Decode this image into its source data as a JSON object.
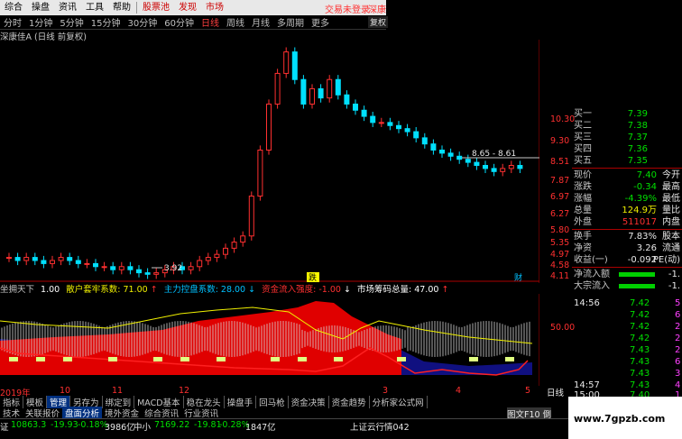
{
  "menu": {
    "items": [
      "综合",
      "操盘",
      "资讯",
      "工具",
      "帮助"
    ],
    "red_items": [
      "股票池",
      "发现",
      "市场"
    ],
    "login_text": "交易未登录",
    "account_text": "深康"
  },
  "periods": {
    "items": [
      "分时",
      "1分钟",
      "5分钟",
      "15分钟",
      "30分钟",
      "60分钟",
      "日线",
      "周线",
      "月线",
      "多周期",
      "更多"
    ],
    "active": "日线",
    "fq_button": "复权"
  },
  "stock_title": "深康佳A (日线 前复权)",
  "price_axis": [
    "10.30",
    "9.30",
    "8.51",
    "7.87",
    "6.97",
    "6.27",
    "5.80",
    "5.35",
    "4.97",
    "4.58",
    "4.11"
  ],
  "chart_annotations": {
    "range_label": "8.65 - 8.61",
    "low_label": "3.92",
    "fall_label": "跌",
    "finance_label": "财"
  },
  "chart_data": {
    "type": "candlestick",
    "ohlc_close_approx": [
      4.5,
      4.4,
      4.5,
      4.4,
      4.3,
      4.4,
      4.5,
      4.4,
      4.3,
      4.3,
      4.2,
      4.2,
      4.1,
      4.2,
      4.1,
      4.0,
      3.95,
      4.0,
      4.1,
      4.2,
      4.1,
      4.2,
      4.4,
      4.5,
      4.6,
      4.8,
      5.0,
      5.2,
      6.5,
      8.0,
      9.5,
      10.5,
      11.2,
      10.3,
      9.5,
      10.0,
      9.7,
      10.3,
      9.8,
      9.5,
      9.3,
      9.1,
      8.9,
      8.9,
      8.8,
      8.7,
      8.6,
      8.4,
      8.2,
      8.0,
      7.9,
      7.8,
      7.7,
      7.6,
      7.5,
      7.4,
      7.3,
      7.4,
      7.5,
      7.4
    ],
    "ylim": [
      3.9,
      11.6
    ]
  },
  "indicator": {
    "name": "坐拥天下",
    "items": [
      {
        "label": "1.00",
        "color": "#ffffff"
      },
      {
        "label": "散户套牢系数: 71.00",
        "color": "#f0f000"
      },
      {
        "label": "↑",
        "color": "#ff3030"
      },
      {
        "label": "主力控盘系数: 28.00",
        "color": "#00c0ff"
      },
      {
        "label": "↓",
        "color": "#00c0ff"
      },
      {
        "label": "资金流入强度: -1.00",
        "color": "#ff3030"
      },
      {
        "label": "↓",
        "color": "#ffffff"
      },
      {
        "label": "市场筹码总量: 47.00",
        "color": "#ffffff"
      },
      {
        "label": "↑",
        "color": "#ff3030"
      }
    ],
    "axis_label": "50.00"
  },
  "quote": {
    "rows": [
      {
        "label": "买一",
        "value": "7.39",
        "vcls": "green"
      },
      {
        "label": "买二",
        "value": "7.38",
        "vcls": "green"
      },
      {
        "label": "买三",
        "value": "7.37",
        "vcls": "green"
      },
      {
        "label": "买四",
        "value": "7.36",
        "vcls": "green"
      },
      {
        "label": "买五",
        "value": "7.35",
        "vcls": "green"
      }
    ],
    "stats": [
      {
        "label": "现价",
        "value": "7.40",
        "vcls": "green",
        "tail": "今开"
      },
      {
        "label": "涨跌",
        "value": "-0.34",
        "vcls": "green",
        "tail": "最高"
      },
      {
        "label": "涨幅",
        "value": "-4.39%",
        "vcls": "green",
        "tail": "最低"
      },
      {
        "label": "总量",
        "value": "124.9万",
        "vcls": "yellow",
        "tail": "量比"
      },
      {
        "label": "外盘",
        "value": "511017",
        "vcls": "red",
        "tail": "内盘"
      },
      {
        "label": "换手",
        "value": "7.83%",
        "vcls": "white",
        "tail": "股本"
      },
      {
        "label": "净资",
        "value": "3.26",
        "vcls": "white",
        "tail": "流通"
      },
      {
        "label": "收益(一)",
        "value": "-0.092",
        "vcls": "white",
        "tail": "PE(动)"
      }
    ],
    "flows": [
      {
        "label": "净流入额",
        "value": "-1."
      },
      {
        "label": "大宗流入",
        "value": "-1."
      }
    ]
  },
  "ticks": [
    {
      "time": "14:56",
      "price": "7.42",
      "vol": "5"
    },
    {
      "time": "",
      "price": "7.42",
      "vol": "6"
    },
    {
      "time": "",
      "price": "7.42",
      "vol": "2"
    },
    {
      "time": "",
      "price": "7.42",
      "vol": "2"
    },
    {
      "time": "",
      "price": "7.43",
      "vol": "2"
    },
    {
      "time": "",
      "price": "7.43",
      "vol": "6"
    },
    {
      "time": "",
      "price": "7.43",
      "vol": "3"
    },
    {
      "time": "",
      "price": "7.43",
      "vol": "1"
    },
    {
      "time": "14:57",
      "price": "7.43",
      "vol": "4"
    },
    {
      "time": "15:00",
      "price": "7.40",
      "vol": "1"
    }
  ],
  "date_axis": [
    "2019年",
    "10",
    "11",
    "12",
    "3",
    "4",
    "5"
  ],
  "daily_label": "日线",
  "tabs": [
    "指标",
    "模板",
    "管理",
    "另存为",
    "绑定到",
    "MACD基本",
    "稳在龙头",
    "操盘手",
    "回马枪",
    "资金决策",
    "资金趋势",
    "分析家公式网"
  ],
  "tabs_active": "管理",
  "tabs2": [
    "技术",
    "关联报价",
    "盘面分析",
    "境外资金",
    "综合资讯",
    "行业资讯"
  ],
  "tabs2_active": "盘面分析",
  "status": {
    "idx1_name": "证",
    "idx1_value": "10863.3",
    "idx1_change": "-19.93",
    "idx1_pct": "-0.18%",
    "idx1_amount": "3986亿",
    "idx2_name": "中小",
    "idx2_value": "7169.22",
    "idx2_change": "-19.81",
    "idx2_pct": "-0.28%",
    "idx2_amount": "1847亿",
    "news": "上证云行情042",
    "tip": "图文F10 倒"
  },
  "watermark": "www.7gpzb.com",
  "colors": {
    "up": "#ff3030",
    "down": "#00e0ff",
    "bg": "#000000"
  }
}
